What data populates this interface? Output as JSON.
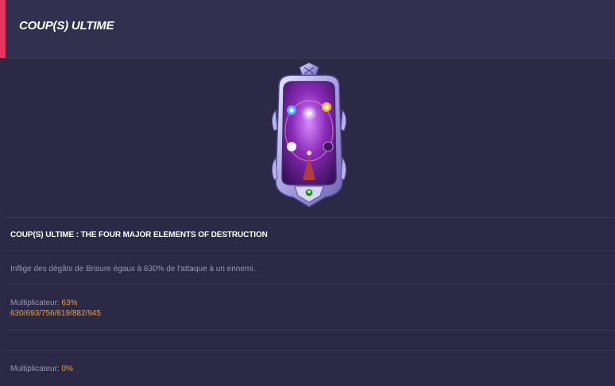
{
  "header": {
    "title": "COUP(S) ULTIME"
  },
  "card": {
    "icon": "ultimate-card-art"
  },
  "skill": {
    "title": "COUP(S) ULTIME : THE FOUR MAJOR ELEMENTS OF DESTRUCTION",
    "description": "Inflige des dégâts de Brisure égaux à 630% de l'attaque à un ennemi.",
    "multiplier1_label": "Multiplicateur: ",
    "multiplier1_value": "63%",
    "multiplier1_levels": "630/693/756/819/882/945",
    "multiplier2_label": "Multiplicateur: ",
    "multiplier2_value": "0%"
  },
  "colors": {
    "accent": "#e8345c",
    "highlight": "#f2a32b",
    "background": "#2c2a47"
  }
}
